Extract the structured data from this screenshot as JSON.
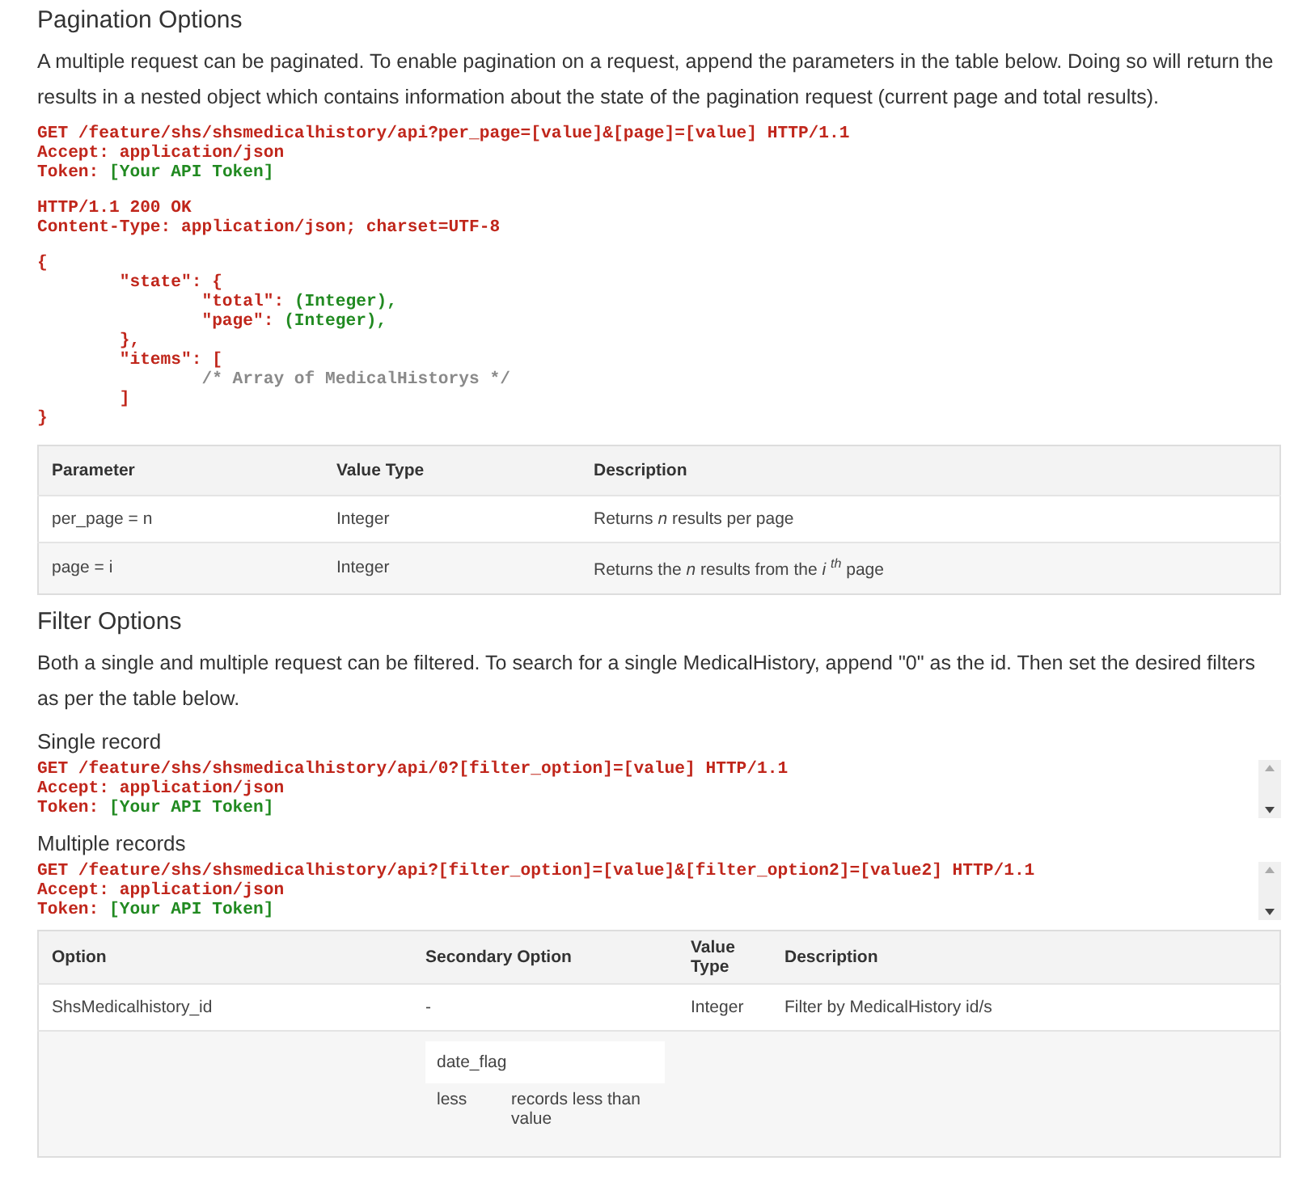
{
  "pagination": {
    "title": "Pagination Options",
    "intro": "A multiple request can be paginated. To enable pagination on a request, append the parameters in the table below. Doing so will return the results in a nested object which contains information about the state of the pagination request (current page and total results).",
    "code_blocks": [
      {
        "lines": [
          [
            {
              "kind": "keyword",
              "text": "GET /feature/shs/shsmedicalhistory/api?per_page=[value]&[page]=[value] HTTP/1.1"
            }
          ],
          [
            {
              "kind": "keyword",
              "text": "Accept: application/json"
            }
          ],
          [
            {
              "kind": "keyword",
              "text": "Token: "
            },
            {
              "kind": "value",
              "text": "[Your API Token]"
            }
          ]
        ]
      },
      {
        "lines": [
          [
            {
              "kind": "keyword",
              "text": "HTTP/1.1 200 OK"
            }
          ],
          [
            {
              "kind": "keyword",
              "text": "Content-Type: application/json; charset=UTF-8"
            }
          ]
        ]
      },
      {
        "lines": [
          [
            {
              "kind": "keyword",
              "text": "{"
            }
          ],
          [
            {
              "kind": "keyword",
              "text": "\t\"state\": {"
            }
          ],
          [
            {
              "kind": "keyword",
              "text": "\t\t\"total\": "
            },
            {
              "kind": "value",
              "text": "(Integer),"
            }
          ],
          [
            {
              "kind": "keyword",
              "text": "\t\t\"page\": "
            },
            {
              "kind": "value",
              "text": "(Integer),"
            }
          ],
          [
            {
              "kind": "keyword",
              "text": "\t},"
            }
          ],
          [
            {
              "kind": "keyword",
              "text": "\t\"items\": ["
            }
          ],
          [
            {
              "kind": "comment",
              "text": "\t\t/* Array of MedicalHistorys */"
            }
          ],
          [
            {
              "kind": "keyword",
              "text": "\t]"
            }
          ],
          [
            {
              "kind": "keyword",
              "text": "}"
            }
          ]
        ]
      }
    ],
    "table": {
      "columns": [
        "Parameter",
        "Value Type",
        "Description"
      ],
      "rows": [
        [
          "per_page = n",
          "Integer",
          "Returns *n* results per page"
        ],
        [
          "page = i",
          "Integer",
          "Returns the *n* results from the *i* $^{th}$ page"
        ]
      ]
    }
  },
  "filter": {
    "title": "Filter Options",
    "intro": "Both a single and multiple request can be filtered. To search for a single MedicalHistory, append \"0\" as the id. Then set the desired filters as per the table below.",
    "requests": [
      {
        "label": "Single record",
        "lines": [
          [
            {
              "kind": "keyword",
              "text": "GET /feature/shs/shsmedicalhistory/api/0?[filter_option]=[value] HTTP/1.1"
            }
          ],
          [
            {
              "kind": "keyword",
              "text": "Accept: application/json"
            }
          ],
          [
            {
              "kind": "keyword",
              "text": "Token: "
            },
            {
              "kind": "value",
              "text": "[Your API Token]"
            }
          ]
        ]
      },
      {
        "label": "Multiple records",
        "lines": [
          [
            {
              "kind": "keyword",
              "text": "GET /feature/shs/shsmedicalhistory/api?[filter_option]=[value]&[filter_option2]=[value2] HTTP/1.1"
            }
          ],
          [
            {
              "kind": "keyword",
              "text": "Accept: application/json"
            }
          ],
          [
            {
              "kind": "keyword",
              "text": "Token: "
            },
            {
              "kind": "value",
              "text": "[Your API Token]"
            }
          ]
        ]
      }
    ],
    "table": {
      "columns": [
        "Option",
        "Secondary Option",
        "Value Type",
        "Description"
      ],
      "rows": [
        {
          "option": "ShsMedicalhistory_id",
          "secondary": {
            "kind": "text",
            "text": "-"
          },
          "value_type": "Integer",
          "description": "Filter by MedicalHistory id/s"
        },
        {
          "secondary": {
            "kind": "table",
            "heading": "date_flag",
            "rows": [
              [
                "less",
                "records less than value"
              ]
            ]
          }
        }
      ]
    }
  }
}
